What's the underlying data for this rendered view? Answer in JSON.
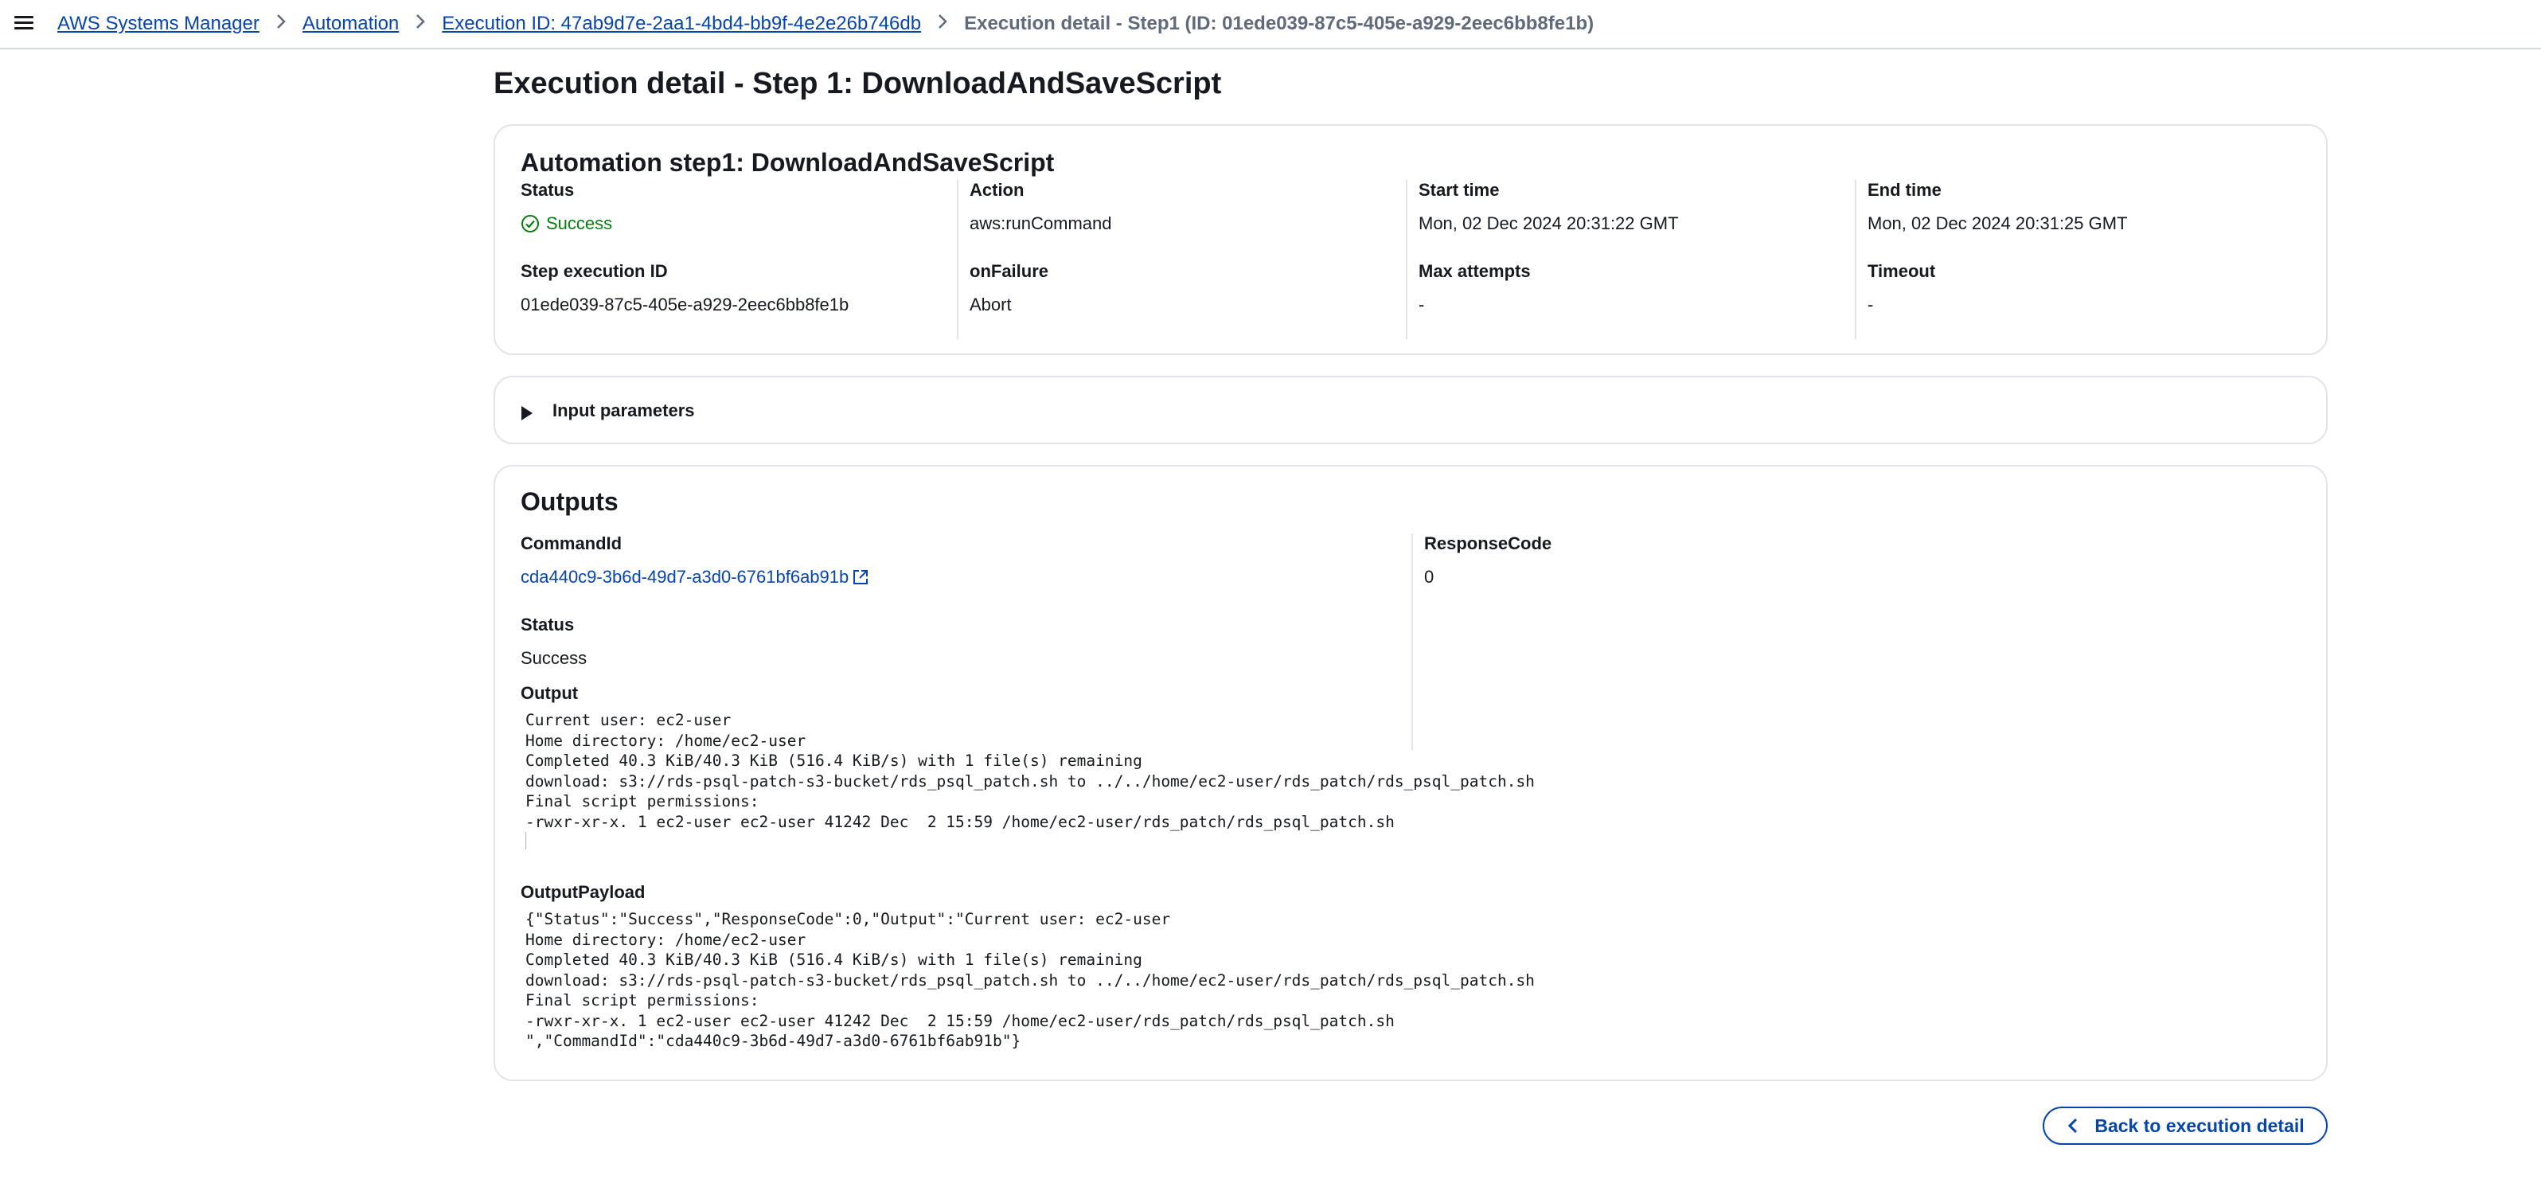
{
  "breadcrumb": {
    "items": [
      "AWS Systems Manager",
      "Automation",
      "Execution ID: 47ab9d7e-2aa1-4bd4-bb9f-4e2e26b746db"
    ],
    "current": "Execution detail - Step1 (ID: 01ede039-87c5-405e-a929-2eec6bb8fe1b)"
  },
  "page": {
    "title": "Execution detail - Step 1: DownloadAndSaveScript"
  },
  "step_card": {
    "title": "Automation step1: DownloadAndSaveScript",
    "fields": {
      "status": {
        "label": "Status",
        "value": "Success"
      },
      "action": {
        "label": "Action",
        "value": "aws:runCommand"
      },
      "start_time": {
        "label": "Start time",
        "value": "Mon, 02 Dec 2024 20:31:22 GMT"
      },
      "end_time": {
        "label": "End time",
        "value": "Mon, 02 Dec 2024 20:31:25 GMT"
      },
      "step_execution_id": {
        "label": "Step execution ID",
        "value": "01ede039-87c5-405e-a929-2eec6bb8fe1b"
      },
      "on_failure": {
        "label": "onFailure",
        "value": "Abort"
      },
      "max_attempts": {
        "label": "Max attempts",
        "value": "-"
      },
      "timeout": {
        "label": "Timeout",
        "value": "-"
      }
    }
  },
  "input_parameters": {
    "label": "Input parameters"
  },
  "outputs": {
    "title": "Outputs",
    "command_id": {
      "label": "CommandId",
      "value": "cda440c9-3b6d-49d7-a3d0-6761bf6ab91b"
    },
    "response_code": {
      "label": "ResponseCode",
      "value": "0"
    },
    "status": {
      "label": "Status",
      "value": "Success"
    },
    "output": {
      "label": "Output",
      "text": "Current user: ec2-user\nHome directory: /home/ec2-user\nCompleted 40.3 KiB/40.3 KiB (516.4 KiB/s) with 1 file(s) remaining\ndownload: s3://rds-psql-patch-s3-bucket/rds_psql_patch.sh to ../../home/ec2-user/rds_patch/rds_psql_patch.sh\nFinal script permissions:\n-rwxr-xr-x. 1 ec2-user ec2-user 41242 Dec  2 15:59 /home/ec2-user/rds_patch/rds_psql_patch.sh"
    },
    "output_payload": {
      "label": "OutputPayload",
      "text": "{\"Status\":\"Success\",\"ResponseCode\":0,\"Output\":\"Current user: ec2-user\nHome directory: /home/ec2-user\nCompleted 40.3 KiB/40.3 KiB (516.4 KiB/s) with 1 file(s) remaining\ndownload: s3://rds-psql-patch-s3-bucket/rds_psql_patch.sh to ../../home/ec2-user/rds_patch/rds_psql_patch.sh\nFinal script permissions:\n-rwxr-xr-x. 1 ec2-user ec2-user 41242 Dec  2 15:59 /home/ec2-user/rds_patch/rds_psql_patch.sh\n\",\"CommandId\":\"cda440c9-3b6d-49d7-a3d0-6761bf6ab91b\"}"
    }
  },
  "actions": {
    "back_label": "Back to execution detail"
  },
  "colors": {
    "link": "#0645ad",
    "success": "#037f0c",
    "border": "#e1e4ea",
    "text": "#16191f"
  }
}
